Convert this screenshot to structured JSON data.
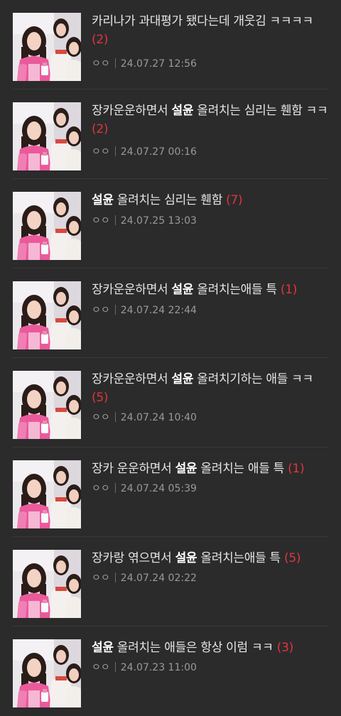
{
  "posts": [
    {
      "pre": "카리나가 과대평가 됐다는데 개웃김 ㅋㅋㅋㅋ",
      "hl": "",
      "post": "",
      "count": "(2)",
      "author": "ㅇㅇ",
      "date": "24.07.27 12:56"
    },
    {
      "pre": "장카운운하면서 ",
      "hl": "설윤",
      "post": " 올려치는 심리는 휀함 ㅋㅋ",
      "count": "(2)",
      "author": "ㅇㅇ",
      "date": "24.07.27 00:16"
    },
    {
      "pre": "",
      "hl": "설윤",
      "post": " 올려치는 심리는 휀함",
      "count": "(7)",
      "author": "ㅇㅇ",
      "date": "24.07.25 13:03"
    },
    {
      "pre": "장카운운하면서 ",
      "hl": "설윤",
      "post": " 올려치는애들 특",
      "count": "(1)",
      "author": "ㅇㅇ",
      "date": "24.07.24 22:44"
    },
    {
      "pre": "장카운운하면서 ",
      "hl": "설윤",
      "post": " 올려치기하는 애들 ㅋㅋ",
      "count": "(5)",
      "author": "ㅇㅇ",
      "date": "24.07.24 10:40"
    },
    {
      "pre": "장카 운운하면서 ",
      "hl": "설윤",
      "post": " 올려치는 애들 특",
      "count": "(1)",
      "author": "ㅇㅇ",
      "date": "24.07.24 05:39"
    },
    {
      "pre": "장카랑 엮으면서 ",
      "hl": "설윤",
      "post": " 올려치는애들 특",
      "count": "(5)",
      "author": "ㅇㅇ",
      "date": "24.07.24 02:22"
    },
    {
      "pre": "",
      "hl": "설윤",
      "post": " 올려치는 애들은 항상 이럼 ㅋㅋ",
      "count": "(3)",
      "author": "ㅇㅇ",
      "date": "24.07.23 11:00"
    }
  ],
  "colors": {
    "background": "#2b2b2b",
    "title": "#e6e6e6",
    "highlight": "#ffffff",
    "count": "#e0353f",
    "meta": "#9a9a9a"
  }
}
